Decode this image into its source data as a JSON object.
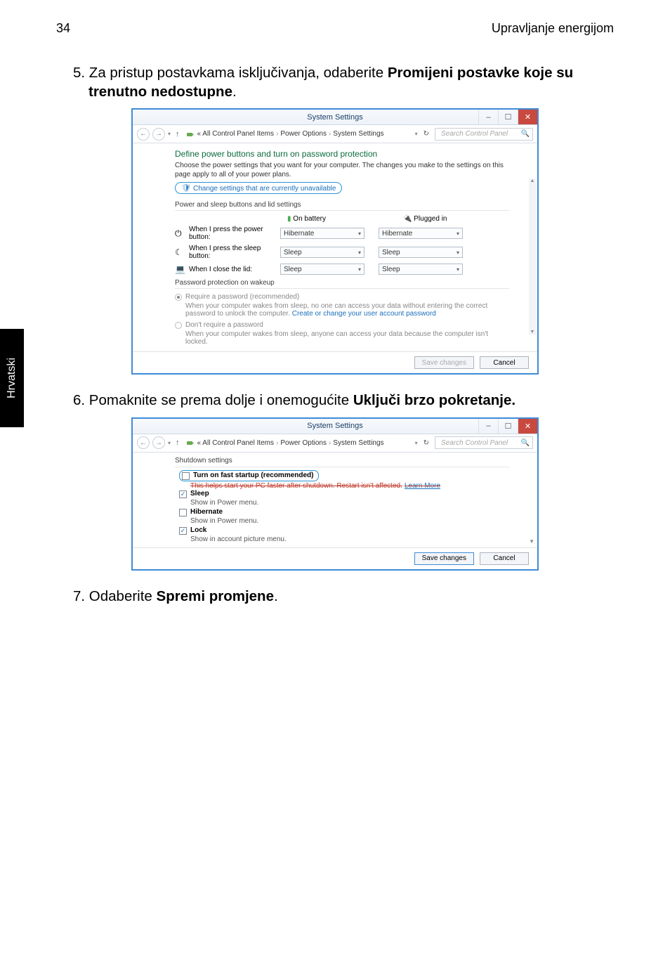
{
  "sidebar_label": "Hrvatski",
  "header": {
    "page_num": "34",
    "section": "Upravljanje energijom"
  },
  "para1_a": "5. Za pristup postavkama isključivanja, odaberite ",
  "para1_b": "Promijeni postavke koje su trenutno nedostupne",
  "para1_c": ".",
  "para2_a": "6. Pomaknite se prema dolje i onemogućite ",
  "para2_b": "Uključi brzo pokretanje.",
  "para3": "7. Odaberite ",
  "para3_b": "Spremi promjene",
  "para3_c": ".",
  "win": {
    "title": "System Settings",
    "breadcrumbs": [
      "« All Control Panel Items",
      "Power Options",
      "System Settings"
    ],
    "search_ph": "Search Control Panel",
    "heading": "Define power buttons and turn on password protection",
    "desc": "Choose the power settings that you want for your computer. The changes you make to the settings on this page apply to all of your power plans.",
    "change_link": "Change settings that are currently unavailable",
    "group1": "Power and sleep buttons and lid settings",
    "col_battery": "On battery",
    "col_plugged": "Plugged in",
    "rows": [
      {
        "label": "When I press the power button:",
        "battery": "Hibernate",
        "plugged": "Hibernate"
      },
      {
        "label": "When I press the sleep button:",
        "battery": "Sleep",
        "plugged": "Sleep"
      },
      {
        "label": "When I close the lid:",
        "battery": "Sleep",
        "plugged": "Sleep"
      }
    ],
    "group2": "Password protection on wakeup",
    "opt1": "Require a password (recommended)",
    "opt1_desc_a": "When your computer wakes from sleep, no one can access your data without entering the correct password to unlock the computer. ",
    "opt1_desc_b": "Create or change your user account password",
    "opt2": "Don't require a password",
    "opt2_desc": "When your computer wakes from sleep, anyone can access your data because the computer isn't locked.",
    "save": "Save changes",
    "cancel": "Cancel"
  },
  "win2": {
    "title": "System Settings",
    "group": "Shutdown settings",
    "fast": "Turn on fast startup (recommended)",
    "fast_desc": "This helps start your PC faster after shutdown. Restart isn't affected.",
    "learn_more": "Learn More",
    "sleep": "Sleep",
    "sleep_desc": "Show in Power menu.",
    "hibernate": "Hibernate",
    "hibernate_desc": "Show in Power menu.",
    "lock": "Lock",
    "lock_desc": "Show in account picture menu.",
    "save": "Save changes",
    "cancel": "Cancel"
  }
}
